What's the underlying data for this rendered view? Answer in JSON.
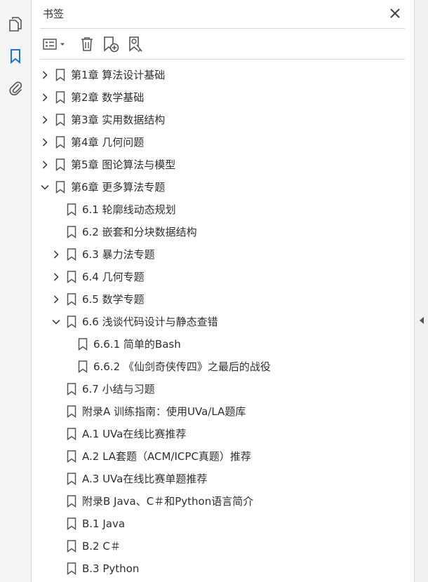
{
  "rail": {
    "pages_icon": "pages-thumbnail-icon",
    "bookmarks_icon": "bookmark-icon",
    "attachments_icon": "paperclip-icon",
    "accent": "#1473e6"
  },
  "panel": {
    "title": "书签",
    "close_icon": "close-icon"
  },
  "toolbar": {
    "options_icon": "options-menu-icon",
    "delete_icon": "trash-icon",
    "new_icon": "new-bookmark-icon",
    "find_icon": "find-bookmark-icon"
  },
  "bookmarks": [
    {
      "label": "第1章 算法设计基础",
      "state": "collapsed"
    },
    {
      "label": "第2章 数学基础",
      "state": "collapsed"
    },
    {
      "label": "第3章 实用数据结构",
      "state": "collapsed"
    },
    {
      "label": "第4章 几何问题",
      "state": "collapsed"
    },
    {
      "label": "第5章 图论算法与模型",
      "state": "collapsed"
    },
    {
      "label": "第6章 更多算法专题",
      "state": "expanded"
    },
    {
      "label": "6.1 轮廓线动态规划",
      "state": "leaf"
    },
    {
      "label": "6.2 嵌套和分块数据结构",
      "state": "leaf"
    },
    {
      "label": "6.3 暴力法专题",
      "state": "collapsed"
    },
    {
      "label": "6.4 几何专题",
      "state": "collapsed"
    },
    {
      "label": "6.5 数学专题",
      "state": "collapsed"
    },
    {
      "label": "6.6 浅谈代码设计与静态查错",
      "state": "expanded"
    },
    {
      "label": "6.6.1 简单的Bash",
      "state": "leaf"
    },
    {
      "label": "6.6.2 《仙剑奇侠传四》之最后的战役",
      "state": "leaf"
    },
    {
      "label": "6.7 小结与习题",
      "state": "leaf"
    },
    {
      "label": "附录A  训练指南：使用UVa/LA题库",
      "state": "leaf"
    },
    {
      "label": "A.1  UVa在线比赛推荐",
      "state": "leaf"
    },
    {
      "label": "A.2  LA套题（ACM/ICPC真题）推荐",
      "state": "leaf"
    },
    {
      "label": "A.3  UVa在线比赛单题推荐",
      "state": "leaf"
    },
    {
      "label": "附录B  Java、C＃和Python语言简介",
      "state": "leaf"
    },
    {
      "label": "B.1  Java",
      "state": "leaf"
    },
    {
      "label": "B.2  C＃",
      "state": "leaf"
    },
    {
      "label": "B.3  Python",
      "state": "leaf"
    }
  ],
  "divider": {
    "collapse_icon": "collapse-left-icon"
  }
}
